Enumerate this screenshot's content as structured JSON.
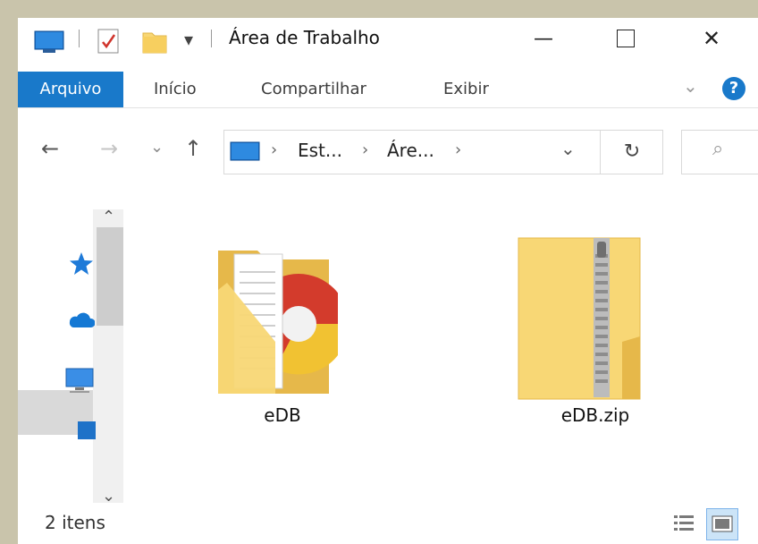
{
  "window": {
    "title": "Área de Trabalho",
    "minimize_symbol": "—",
    "maximize_symbol": "☐",
    "close_symbol": "✕"
  },
  "quick_access": {
    "dropdown_symbol": "▾",
    "icons": [
      "desktop-icon",
      "properties-icon",
      "new-folder-icon"
    ]
  },
  "ribbon": {
    "tabs": [
      {
        "label": "Arquivo",
        "active": true
      },
      {
        "label": "Início"
      },
      {
        "label": "Compartilhar"
      },
      {
        "label": "Exibir"
      }
    ],
    "expand_symbol": "⌄",
    "help_symbol": "?"
  },
  "navigation": {
    "back_symbol": "←",
    "forward_symbol": "→",
    "recent_symbol": "⌄",
    "up_symbol": "↑",
    "breadcrumb": [
      {
        "label": "Est..."
      },
      {
        "label": "Áre..."
      }
    ],
    "separator_symbol": "›",
    "dropdown_symbol": "⌄",
    "refresh_symbol": "↻",
    "search_symbol": "⌕"
  },
  "nav_pane": {
    "items": [
      "quick-access-icon",
      "onedrive-icon",
      "this-pc-icon",
      "desktop-icon"
    ],
    "scroll_up_symbol": "⌃",
    "scroll_down_symbol": "⌄"
  },
  "files": [
    {
      "name": "eDB",
      "icon": "folder-icon"
    },
    {
      "name": "eDB.zip",
      "icon": "zip-folder-icon"
    }
  ],
  "status": {
    "item_count": "2 itens"
  },
  "colors": {
    "accent": "#1979ca",
    "folder": "#f8d775",
    "folder_dark": "#e6b84a",
    "background": "#c9c4ab"
  }
}
